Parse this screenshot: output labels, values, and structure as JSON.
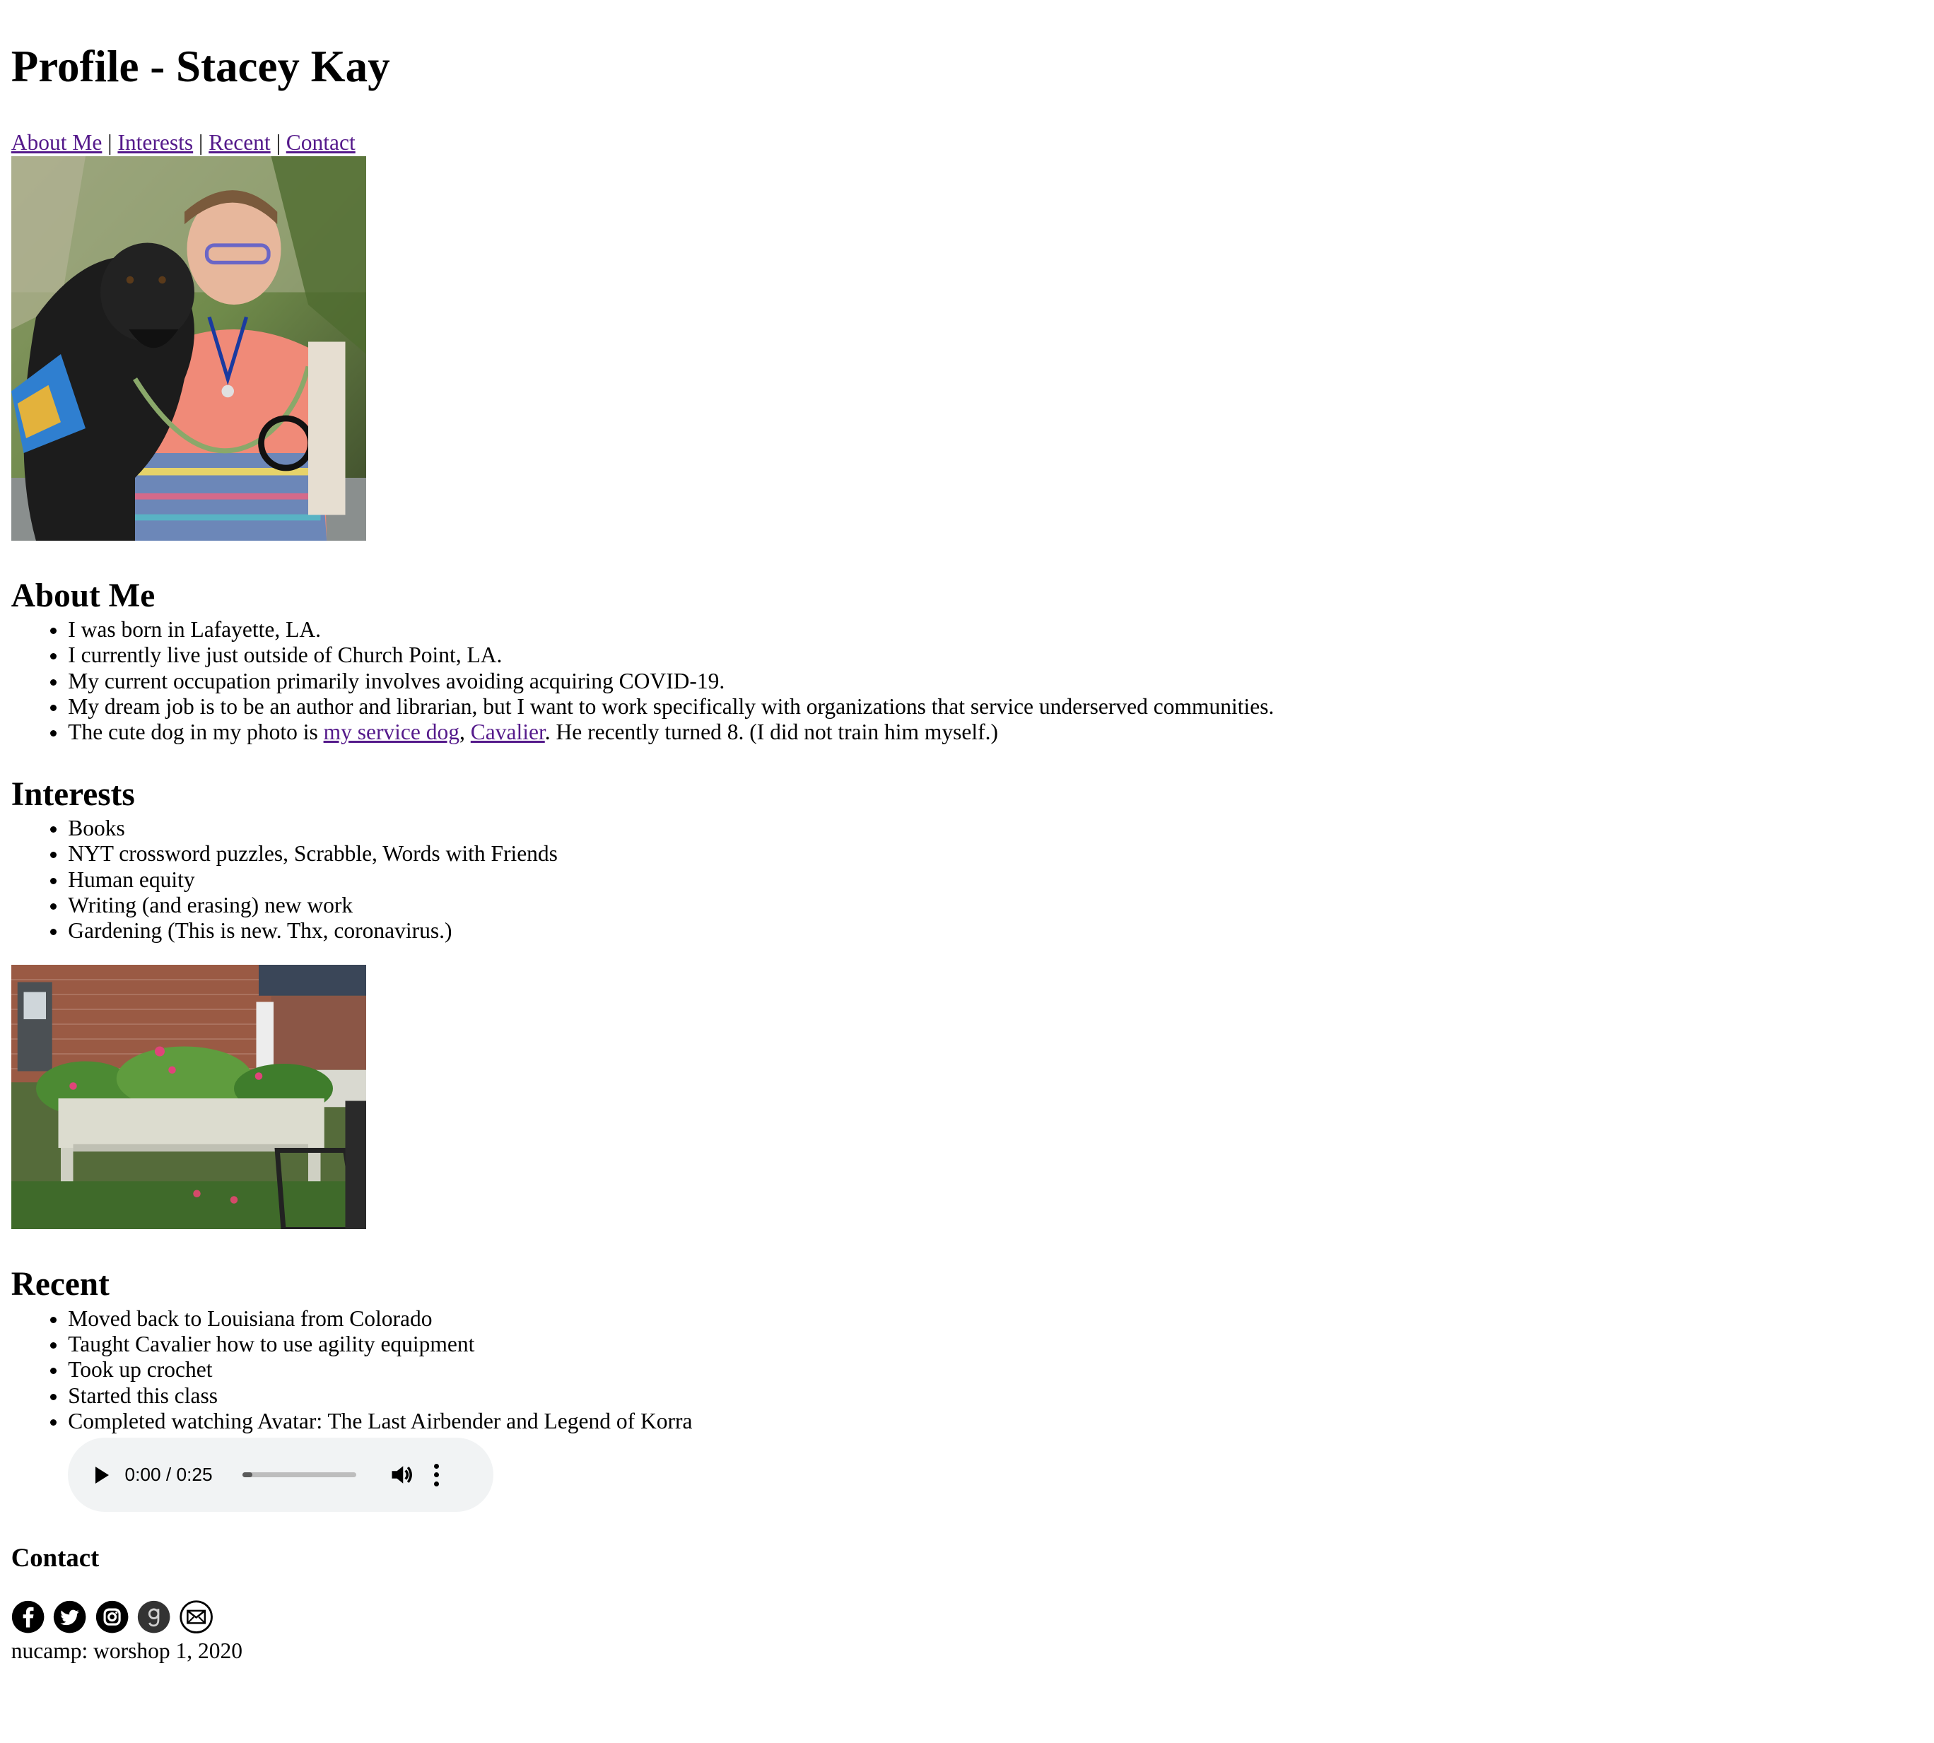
{
  "page": {
    "title": "Profile - Stacey Kay"
  },
  "nav": {
    "items": [
      {
        "label": "About Me"
      },
      {
        "label": "Interests"
      },
      {
        "label": "Recent"
      },
      {
        "label": "Contact"
      }
    ],
    "separator": "|"
  },
  "about": {
    "heading": "About Me",
    "items": [
      "I was born in Lafayette, LA.",
      "I currently live just outside of Church Point, LA.",
      "My current occupation primarily involves avoiding acquiring COVID-19.",
      "My dream job is to be an author and librarian, but I want to work specifically with organizations that service underserved communities."
    ],
    "dog_item": {
      "prefix": "The cute dog in my photo is ",
      "link1": "my service dog",
      "comma": ", ",
      "link2": "Cavalier",
      "suffix": ". He recently turned 8. (I did not train him myself.)"
    }
  },
  "interests": {
    "heading": "Interests",
    "items": [
      "Books",
      "NYT crossword puzzles, Scrabble, Words with Friends",
      "Human equity",
      "Writing (and erasing) new work",
      "Gardening (This is new. Thx, coronavirus.)"
    ]
  },
  "recent": {
    "heading": "Recent",
    "items": [
      "Moved back to Louisiana from Colorado",
      "Taught Cavalier how to use agility equipment",
      "Took up crochet",
      "Started this class",
      "Completed watching Avatar: The Last Airbender and Legend of Korra"
    ]
  },
  "audio": {
    "time": "0:00 / 0:25",
    "progress": 0.09,
    "play_icon": "play-icon",
    "volume_icon": "volume-icon",
    "more_icon": "more-vertical-icon"
  },
  "contact": {
    "heading": "Contact",
    "icons": [
      "facebook-icon",
      "twitter-icon",
      "instagram-icon",
      "goodreads-icon",
      "email-icon"
    ]
  },
  "footer": {
    "text": "nucamp: worshop 1, 2020"
  },
  "colors": {
    "link": "#551a8b",
    "audio_bg": "#f1f3f4",
    "goodreads_bg": "#333333"
  }
}
